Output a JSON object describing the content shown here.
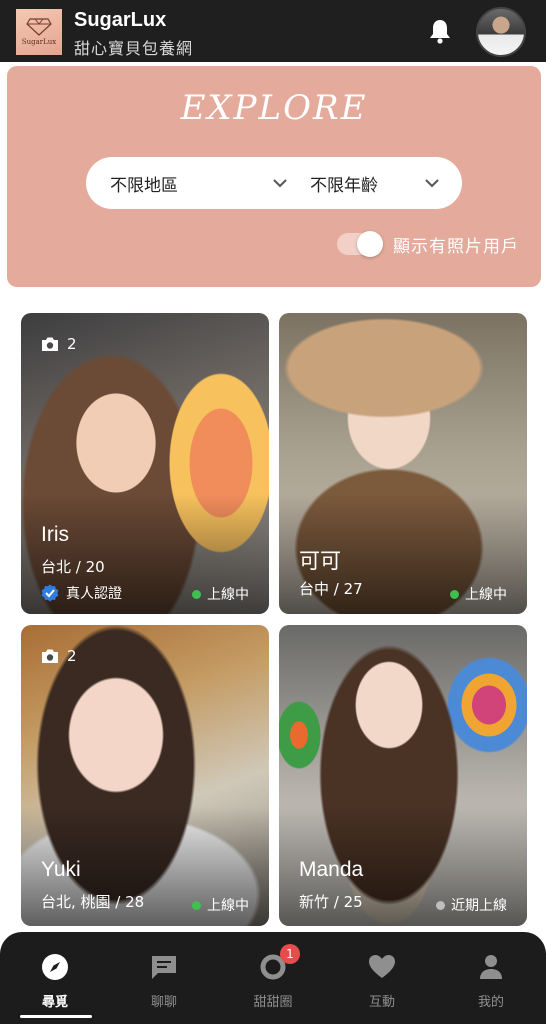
{
  "header": {
    "logo_text": "SugarLux",
    "app_name": "SugarLux",
    "subtitle": "甜心寶貝包養網",
    "bell_icon": "bell-icon",
    "avatar_icon": "user-avatar"
  },
  "explore": {
    "title": "EXPLORE",
    "region_filter": "不限地區",
    "age_filter": "不限年齡",
    "photo_toggle_label": "顯示有照片用戶",
    "photo_toggle_on": true
  },
  "profiles": [
    {
      "photo_count": "2",
      "name": "Iris",
      "meta": "台北 / 20",
      "verified_label": "真人認證",
      "status": "上線中",
      "status_color": "#3fbf4f"
    },
    {
      "photo_count": "",
      "name": "可可",
      "meta": "台中 / 27",
      "verified_label": "",
      "status": "上線中",
      "status_color": "#3fbf4f"
    },
    {
      "photo_count": "2",
      "name": "Yuki",
      "meta": "台北, 桃園 / 28",
      "verified_label": "",
      "status": "上線中",
      "status_color": "#3fbf4f"
    },
    {
      "photo_count": "",
      "name": "Manda",
      "meta": "新竹 / 25",
      "verified_label": "",
      "status": "近期上線",
      "status_color": "#bdbdbd"
    }
  ],
  "nav": {
    "items": [
      {
        "label": "尋覓",
        "icon": "compass-icon",
        "active": true
      },
      {
        "label": "聊聊",
        "icon": "chat-icon",
        "active": false
      },
      {
        "label": "甜甜圈",
        "icon": "donut-icon",
        "active": false,
        "badge": "1"
      },
      {
        "label": "互動",
        "icon": "heart-icon",
        "active": false
      },
      {
        "label": "我的",
        "icon": "person-icon",
        "active": false
      }
    ]
  },
  "colors": {
    "header_bg": "#1f1f1f",
    "explore_bg": "#e4aa9c",
    "online": "#3fbf4f",
    "verified_blue": "#2f7de1",
    "badge_red": "#e74c4c"
  }
}
